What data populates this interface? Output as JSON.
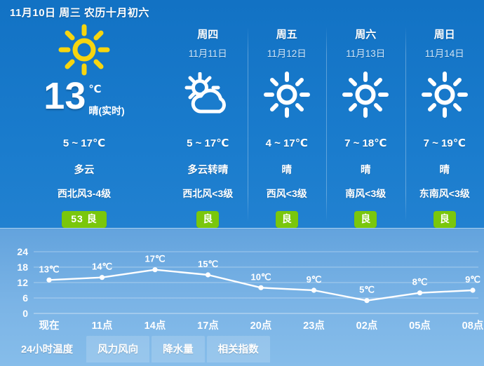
{
  "header": {
    "title": "11月10日 周三 农历十月初六"
  },
  "today": {
    "icon": "sun-icon",
    "icon_color": "#f7d50f",
    "temperature": "13",
    "unit": "℃",
    "condition_live": "晴(实时)",
    "range": "5 ~ 17℃",
    "condition": "多云",
    "wind": "西北风3-4级",
    "aqi": "53  良",
    "aqi_color": "#7ac70c"
  },
  "forecast": [
    {
      "weekday": "周四",
      "date": "11月11日",
      "icon": "sun-behind-cloud-icon",
      "range": "5 ~ 17℃",
      "condition": "多云转晴",
      "wind": "西北风<3级",
      "aqi": "良"
    },
    {
      "weekday": "周五",
      "date": "11月12日",
      "icon": "sun-icon",
      "range": "4 ~ 17℃",
      "condition": "晴",
      "wind": "西风<3级",
      "aqi": "良"
    },
    {
      "weekday": "周六",
      "date": "11月13日",
      "icon": "sun-icon",
      "range": "7 ~ 18℃",
      "condition": "晴",
      "wind": "南风<3级",
      "aqi": "良"
    },
    {
      "weekday": "周日",
      "date": "11月14日",
      "icon": "sun-icon",
      "range": "7 ~ 19℃",
      "condition": "晴",
      "wind": "东南风<3级",
      "aqi": "良"
    }
  ],
  "chart_data": {
    "type": "line",
    "title": "",
    "xlabel": "",
    "ylabel": "",
    "categories": [
      "现在",
      "11点",
      "14点",
      "17点",
      "20点",
      "23点",
      "02点",
      "05点",
      "08点"
    ],
    "values": [
      13,
      14,
      17,
      15,
      10,
      9,
      5,
      8,
      9
    ],
    "point_labels": [
      "13℃",
      "14℃",
      "17℃",
      "15℃",
      "10℃",
      "9℃",
      "5℃",
      "8℃",
      "9℃"
    ],
    "yticks": [
      24,
      18,
      12,
      6,
      0
    ],
    "ylim": [
      0,
      24
    ],
    "grid": true,
    "legend": "none",
    "line_color": "#ffffff",
    "point_color": "#ffffff"
  },
  "tabs": [
    {
      "label": "24小时温度",
      "active": true
    },
    {
      "label": "风力风向",
      "active": false
    },
    {
      "label": "降水量",
      "active": false
    },
    {
      "label": "相关指数",
      "active": false
    }
  ]
}
